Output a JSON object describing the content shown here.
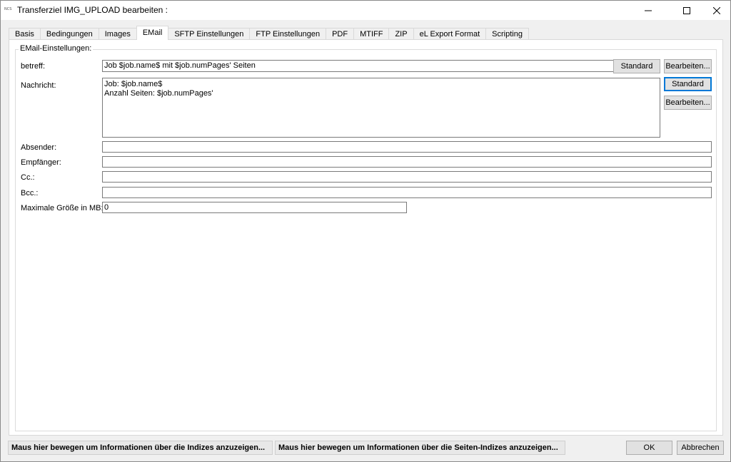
{
  "window": {
    "title": "Transferziel IMG_UPLOAD bearbeiten :",
    "icon_text": "NCS"
  },
  "tabs": [
    {
      "label": "Basis",
      "active": false
    },
    {
      "label": "Bedingungen",
      "active": false
    },
    {
      "label": "Images",
      "active": false
    },
    {
      "label": "EMail",
      "active": true
    },
    {
      "label": "SFTP Einstellungen",
      "active": false
    },
    {
      "label": "FTP Einstellungen",
      "active": false
    },
    {
      "label": "PDF",
      "active": false
    },
    {
      "label": "MTIFF",
      "active": false
    },
    {
      "label": "ZIP",
      "active": false
    },
    {
      "label": "eL Export Format",
      "active": false
    },
    {
      "label": "Scripting",
      "active": false
    }
  ],
  "email": {
    "group_label": "EMail-Einstellungen:",
    "betreff_label": "betreff:",
    "betreff_value": "Job $job.name$ mit $job.numPages' Seiten",
    "standard_label": "Standard",
    "bearbeiten_label": "Bearbeiten...",
    "nachricht_label": "Nachricht:",
    "nachricht_lines": [
      "Job: $job.name$",
      "Anzahl Seiten: $job.numPages'"
    ],
    "absender_label": "Absender:",
    "absender_value": "",
    "empfaenger_label": "Empfänger:",
    "empfaenger_value": "",
    "cc_label": "Cc.:",
    "cc_value": "",
    "bcc_label": "Bcc.:",
    "bcc_value": "",
    "maxsize_label": "Maximale Größe in MB:",
    "maxsize_value": "0"
  },
  "footer": {
    "info_indizes": "Maus hier bewegen um Informationen über die Indizes anzuzeigen...",
    "info_seiten_indizes": "Maus hier bewegen um Informationen über die Seiten-Indizes anzuzeigen...",
    "ok_label": "OK",
    "cancel_label": "Abbrechen"
  },
  "colors": {
    "focus_border": "#0078d7",
    "button_face": "#e1e1e1",
    "window_bg": "#f0f0f0"
  }
}
